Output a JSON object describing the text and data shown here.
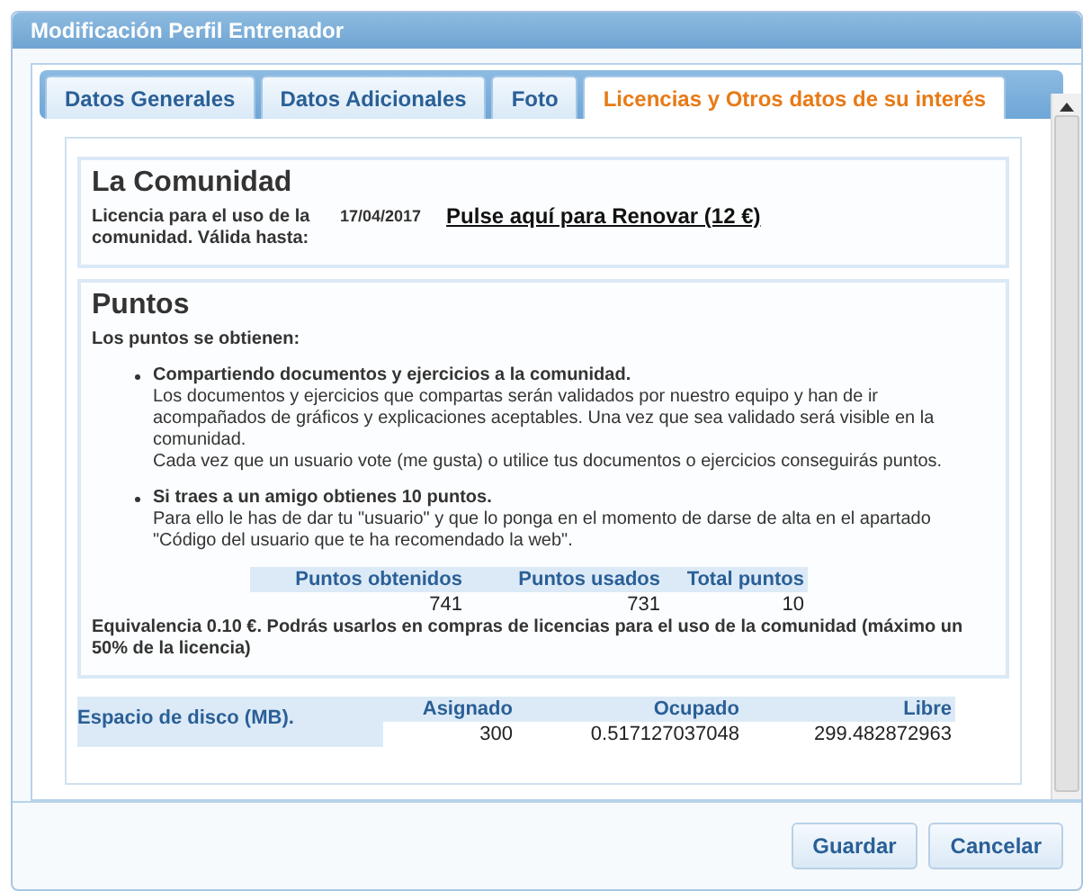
{
  "window": {
    "title": "Modificación Perfil Entrenador"
  },
  "tabs": [
    {
      "label": "Datos Generales",
      "selected": false
    },
    {
      "label": "Datos Adicionales",
      "selected": false
    },
    {
      "label": "Foto",
      "selected": false
    },
    {
      "label": "Licencias y Otros datos de su interés",
      "selected": true
    }
  ],
  "comunidad": {
    "title": "La Comunidad",
    "license_label": "Licencia para el uso de la comunidad. Válida hasta:",
    "date": "17/04/2017",
    "renew_link": "Pulse aquí para Renovar (12 €)"
  },
  "puntos": {
    "title": "Puntos",
    "intro": "Los puntos se obtienen:",
    "items": [
      {
        "heading": "Compartiendo documentos y ejercicios a la comunidad.",
        "lines": [
          "Los documentos y ejercicios que compartas serán validados por nuestro equipo y han de ir acompañados de gráficos y explicaciones aceptables. Una vez que sea validado será visible en la comunidad.",
          "Cada vez que un usuario vote (me gusta) o utilice tus documentos o ejercicios conseguirás puntos."
        ]
      },
      {
        "heading": "Si traes a un amigo obtienes 10 puntos.",
        "lines": [
          "Para ello le has de dar tu \"usuario\" y que lo ponga en el momento de darse de alta en el apartado \"Código del usuario que te ha recomendado la web\"."
        ]
      }
    ],
    "table": {
      "columns": [
        "Puntos obtenidos",
        "Puntos usados",
        "Total puntos"
      ],
      "values": [
        "741",
        "731",
        "10"
      ]
    },
    "note": "Equivalencia 0.10  €. Podrás usarlos en compras de licencias para el uso de la comunidad (máximo un 50% de la licencia)"
  },
  "disk": {
    "label": "Espacio de disco (MB).",
    "columns": [
      "Asignado",
      "Ocupado",
      "Libre"
    ],
    "values": [
      "300",
      "0.517127037048",
      "299.482872963"
    ]
  },
  "buttons": [
    "Guardar",
    "Cancelar"
  ]
}
